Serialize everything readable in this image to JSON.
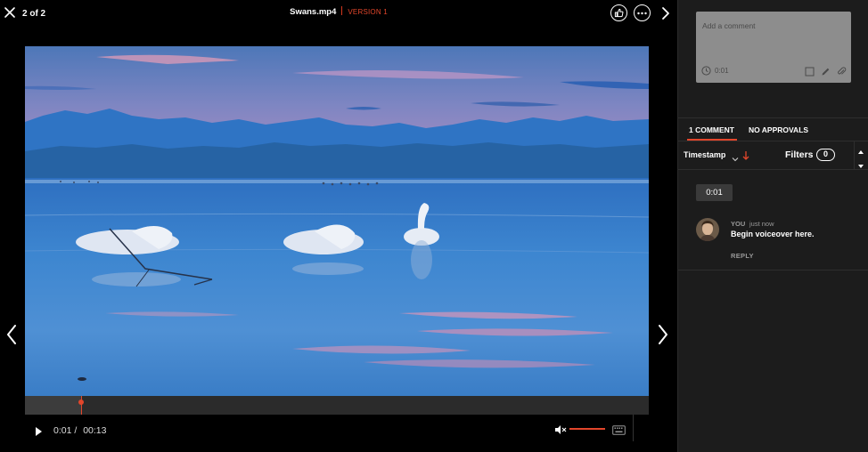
{
  "header": {
    "counter": "2 of 2",
    "file_name": "Swans.mp4",
    "version": "VERSION 1"
  },
  "player": {
    "current_time": "0:01 /",
    "duration": "00:13",
    "progress_fraction": 0.09,
    "volume_fraction": 1.0
  },
  "comment_box": {
    "placeholder": "Add a comment",
    "timestamp": "0:01"
  },
  "tabs": {
    "comments": "1 COMMENT",
    "approvals": "NO APPROVALS"
  },
  "filter_bar": {
    "sort_label": "Timestamp",
    "filters_label": "Filters",
    "filters_count": "0"
  },
  "comment": {
    "timestamp": "0:01",
    "author": "YOU",
    "time_ago": "just now",
    "text": "Begin voiceover here.",
    "reply_label": "REPLY"
  },
  "colors": {
    "accent": "#e2462b",
    "sidebar_bg": "#1c1c1c",
    "comment_box_bg": "#8d8d8d"
  }
}
